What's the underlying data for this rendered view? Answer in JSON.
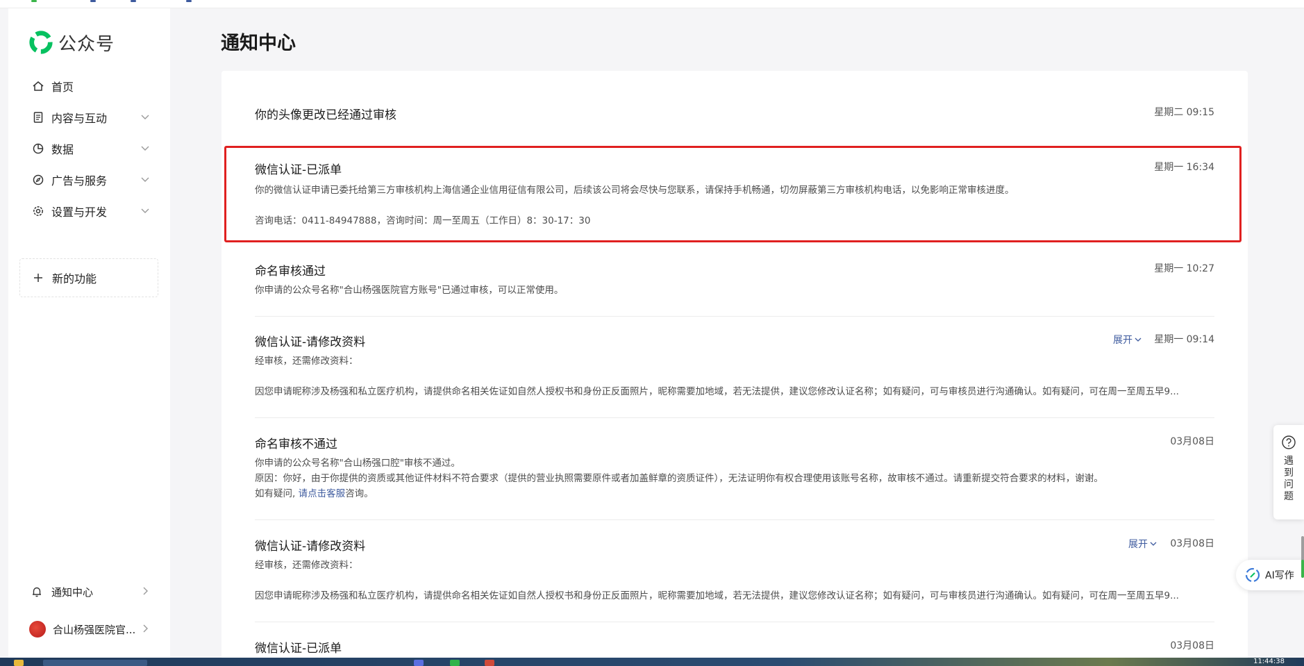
{
  "app": {
    "name": "公众号",
    "brand_color": "#07c160"
  },
  "sidebar": {
    "items": [
      {
        "label": "首页",
        "icon": "home-icon",
        "has_chevron": false
      },
      {
        "label": "内容与互动",
        "icon": "document-icon",
        "has_chevron": true
      },
      {
        "label": "数据",
        "icon": "pie-chart-icon",
        "has_chevron": true
      },
      {
        "label": "广告与服务",
        "icon": "compass-icon",
        "has_chevron": true
      },
      {
        "label": "设置与开发",
        "icon": "gear-icon",
        "has_chevron": true
      }
    ],
    "new_feature": "新的功能",
    "notification_center": "通知中心",
    "account_name": "合山杨强医院官..."
  },
  "page": {
    "title": "通知中心"
  },
  "notices": [
    {
      "title": "你的头像更改已经通过审核",
      "time": "星期二 09:15",
      "lines": []
    },
    {
      "title": "微信认证-已派单",
      "time": "星期一 16:34",
      "highlighted": true,
      "lines": [
        "你的微信认证申请已委托给第三方审核机构上海信通企业信用征信有限公司，后续该公司将会尽快与您联系，请保持手机畅通，切勿屏蔽第三方审核机构电话，以免影响正常审核进度。",
        "",
        "咨询电话：0411-84947888，咨询时间：周一至周五（工作日）8：30-17：30"
      ]
    },
    {
      "title": "命名审核通过",
      "time": "星期一 10:27",
      "lines": [
        "你申请的公众号名称\"合山杨强医院官方账号\"已通过审核，可以正常使用。"
      ]
    },
    {
      "title": "微信认证-请修改资料",
      "time": "星期一 09:14",
      "expand": "展开",
      "lines": [
        "经审核，还需修改资料：",
        "",
        "因您申请昵称涉及杨强和私立医疗机构，请提供命名相关佐证如自然人授权书和身份正反面照片，昵称需要加地域，若无法提供，建议您修改认证名称；如有疑问，可与审核员进行沟通确认。如有疑问，可在周一至周五早9..."
      ]
    },
    {
      "title": "命名审核不通过",
      "time": "03月08日",
      "lines": [
        "你申请的公众号名称\"合山杨强口腔\"审核不通过。",
        "原因：你好，由于你提供的资质或其他证件材料不符合要求（提供的营业执照需要原件或者加盖鲜章的资质证件），无法证明你有权合理使用该账号名称，故审核不通过。请重新提交符合要求的材料，谢谢。"
      ],
      "contact_prefix": "如有疑问, ",
      "contact_link": "请点击客服",
      "contact_suffix": "咨询。"
    },
    {
      "title": "微信认证-请修改资料",
      "time": "03月08日",
      "expand": "展开",
      "lines": [
        "经审核，还需修改资料：",
        "",
        "因您申请昵称涉及杨强和私立医疗机构，请提供命名相关佐证如自然人授权书和身份正反面照片，昵称需要加地域，若无法提供，建议您修改认证名称；如有疑问，可与审核员进行沟通确认。如有疑问，可在周一至周五早9..."
      ]
    },
    {
      "title": "微信认证-已派单",
      "time": "03月08日",
      "lines": []
    }
  ],
  "floating": {
    "help": "遇到问题",
    "ai_write": "AI写作"
  },
  "taskbar": {
    "clock": "11:44:38"
  },
  "colors": {
    "highlight_border": "#e02020",
    "link": "#3d5a9e"
  }
}
